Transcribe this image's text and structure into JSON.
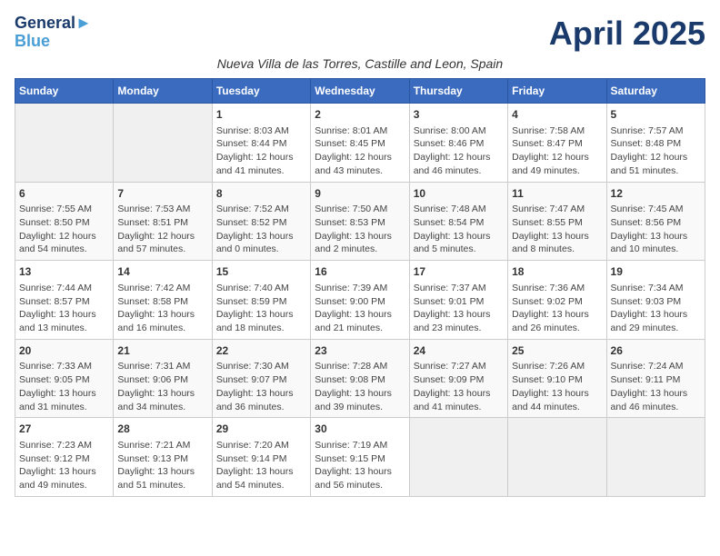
{
  "header": {
    "logo_line1": "General",
    "logo_line2": "Blue",
    "month_title": "April 2025",
    "subtitle": "Nueva Villa de las Torres, Castille and Leon, Spain"
  },
  "days_of_week": [
    "Sunday",
    "Monday",
    "Tuesday",
    "Wednesday",
    "Thursday",
    "Friday",
    "Saturday"
  ],
  "weeks": [
    [
      {
        "day": "",
        "content": ""
      },
      {
        "day": "",
        "content": ""
      },
      {
        "day": "1",
        "content": "Sunrise: 8:03 AM\nSunset: 8:44 PM\nDaylight: 12 hours and 41 minutes."
      },
      {
        "day": "2",
        "content": "Sunrise: 8:01 AM\nSunset: 8:45 PM\nDaylight: 12 hours and 43 minutes."
      },
      {
        "day": "3",
        "content": "Sunrise: 8:00 AM\nSunset: 8:46 PM\nDaylight: 12 hours and 46 minutes."
      },
      {
        "day": "4",
        "content": "Sunrise: 7:58 AM\nSunset: 8:47 PM\nDaylight: 12 hours and 49 minutes."
      },
      {
        "day": "5",
        "content": "Sunrise: 7:57 AM\nSunset: 8:48 PM\nDaylight: 12 hours and 51 minutes."
      }
    ],
    [
      {
        "day": "6",
        "content": "Sunrise: 7:55 AM\nSunset: 8:50 PM\nDaylight: 12 hours and 54 minutes."
      },
      {
        "day": "7",
        "content": "Sunrise: 7:53 AM\nSunset: 8:51 PM\nDaylight: 12 hours and 57 minutes."
      },
      {
        "day": "8",
        "content": "Sunrise: 7:52 AM\nSunset: 8:52 PM\nDaylight: 13 hours and 0 minutes."
      },
      {
        "day": "9",
        "content": "Sunrise: 7:50 AM\nSunset: 8:53 PM\nDaylight: 13 hours and 2 minutes."
      },
      {
        "day": "10",
        "content": "Sunrise: 7:48 AM\nSunset: 8:54 PM\nDaylight: 13 hours and 5 minutes."
      },
      {
        "day": "11",
        "content": "Sunrise: 7:47 AM\nSunset: 8:55 PM\nDaylight: 13 hours and 8 minutes."
      },
      {
        "day": "12",
        "content": "Sunrise: 7:45 AM\nSunset: 8:56 PM\nDaylight: 13 hours and 10 minutes."
      }
    ],
    [
      {
        "day": "13",
        "content": "Sunrise: 7:44 AM\nSunset: 8:57 PM\nDaylight: 13 hours and 13 minutes."
      },
      {
        "day": "14",
        "content": "Sunrise: 7:42 AM\nSunset: 8:58 PM\nDaylight: 13 hours and 16 minutes."
      },
      {
        "day": "15",
        "content": "Sunrise: 7:40 AM\nSunset: 8:59 PM\nDaylight: 13 hours and 18 minutes."
      },
      {
        "day": "16",
        "content": "Sunrise: 7:39 AM\nSunset: 9:00 PM\nDaylight: 13 hours and 21 minutes."
      },
      {
        "day": "17",
        "content": "Sunrise: 7:37 AM\nSunset: 9:01 PM\nDaylight: 13 hours and 23 minutes."
      },
      {
        "day": "18",
        "content": "Sunrise: 7:36 AM\nSunset: 9:02 PM\nDaylight: 13 hours and 26 minutes."
      },
      {
        "day": "19",
        "content": "Sunrise: 7:34 AM\nSunset: 9:03 PM\nDaylight: 13 hours and 29 minutes."
      }
    ],
    [
      {
        "day": "20",
        "content": "Sunrise: 7:33 AM\nSunset: 9:05 PM\nDaylight: 13 hours and 31 minutes."
      },
      {
        "day": "21",
        "content": "Sunrise: 7:31 AM\nSunset: 9:06 PM\nDaylight: 13 hours and 34 minutes."
      },
      {
        "day": "22",
        "content": "Sunrise: 7:30 AM\nSunset: 9:07 PM\nDaylight: 13 hours and 36 minutes."
      },
      {
        "day": "23",
        "content": "Sunrise: 7:28 AM\nSunset: 9:08 PM\nDaylight: 13 hours and 39 minutes."
      },
      {
        "day": "24",
        "content": "Sunrise: 7:27 AM\nSunset: 9:09 PM\nDaylight: 13 hours and 41 minutes."
      },
      {
        "day": "25",
        "content": "Sunrise: 7:26 AM\nSunset: 9:10 PM\nDaylight: 13 hours and 44 minutes."
      },
      {
        "day": "26",
        "content": "Sunrise: 7:24 AM\nSunset: 9:11 PM\nDaylight: 13 hours and 46 minutes."
      }
    ],
    [
      {
        "day": "27",
        "content": "Sunrise: 7:23 AM\nSunset: 9:12 PM\nDaylight: 13 hours and 49 minutes."
      },
      {
        "day": "28",
        "content": "Sunrise: 7:21 AM\nSunset: 9:13 PM\nDaylight: 13 hours and 51 minutes."
      },
      {
        "day": "29",
        "content": "Sunrise: 7:20 AM\nSunset: 9:14 PM\nDaylight: 13 hours and 54 minutes."
      },
      {
        "day": "30",
        "content": "Sunrise: 7:19 AM\nSunset: 9:15 PM\nDaylight: 13 hours and 56 minutes."
      },
      {
        "day": "",
        "content": ""
      },
      {
        "day": "",
        "content": ""
      },
      {
        "day": "",
        "content": ""
      }
    ]
  ]
}
